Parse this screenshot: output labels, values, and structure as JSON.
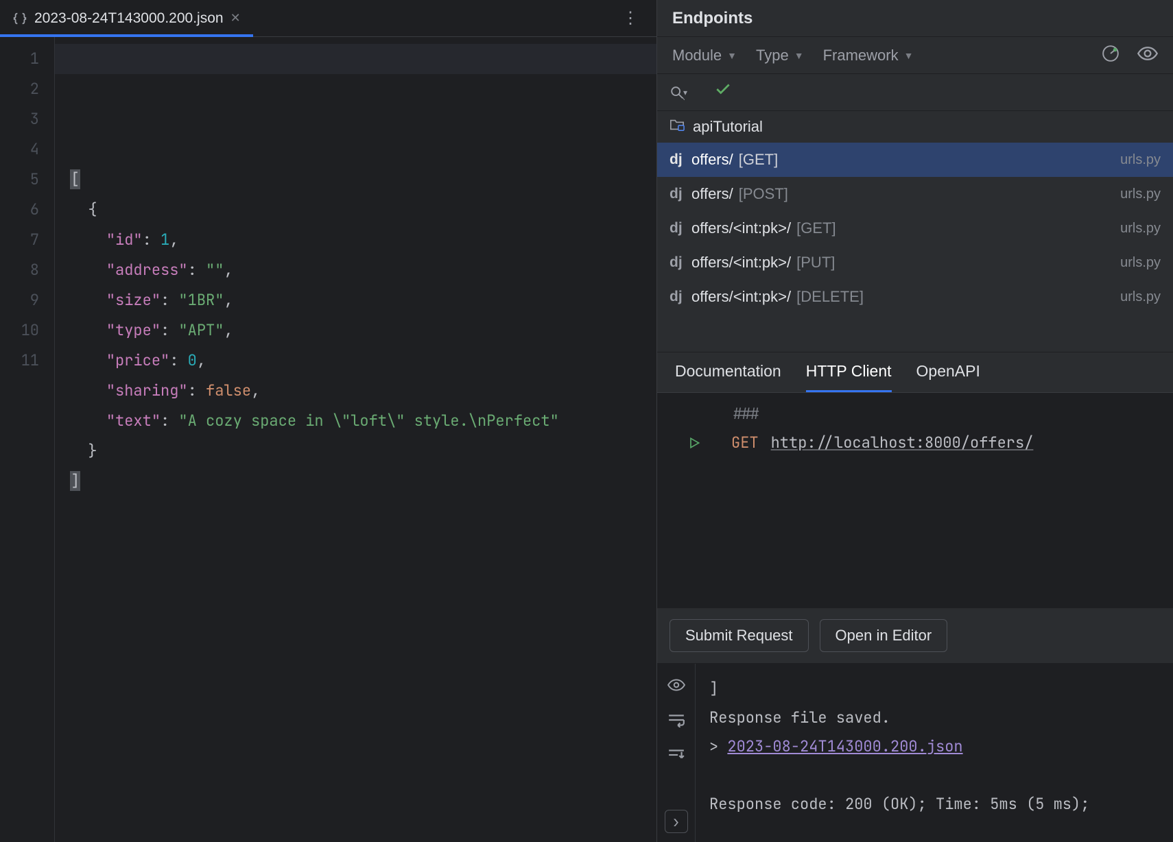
{
  "editor": {
    "tab_title": "2023-08-24T143000.200.json",
    "line_numbers": [
      "1",
      "2",
      "3",
      "4",
      "5",
      "6",
      "7",
      "8",
      "9",
      "10",
      "11"
    ],
    "json_content": {
      "id": 1,
      "address": "",
      "size": "1BR",
      "type": "APT",
      "price": 0,
      "sharing": false,
      "text": "A cozy space in \\\"loft\\\" style.\\nPerfect"
    }
  },
  "endpoints": {
    "title": "Endpoints",
    "filters": {
      "module": "Module",
      "type": "Type",
      "framework": "Framework"
    },
    "group": "apiTutorial",
    "list": [
      {
        "path": "offers/",
        "method": "[GET]",
        "source": "urls.py",
        "selected": true
      },
      {
        "path": "offers/",
        "method": "[POST]",
        "source": "urls.py",
        "selected": false
      },
      {
        "path": "offers/<int:pk>/",
        "method": "[GET]",
        "source": "urls.py",
        "selected": false
      },
      {
        "path": "offers/<int:pk>/",
        "method": "[PUT]",
        "source": "urls.py",
        "selected": false
      },
      {
        "path": "offers/<int:pk>/",
        "method": "[DELETE]",
        "source": "urls.py",
        "selected": false
      }
    ],
    "detail_tabs": {
      "documentation": "Documentation",
      "http_client": "HTTP Client",
      "openapi": "OpenAPI",
      "active": "http_client"
    },
    "http": {
      "separator": "###",
      "method": "GET",
      "url": "http://localhost:8000/offers/"
    },
    "actions": {
      "submit": "Submit Request",
      "open": "Open in Editor"
    },
    "response": {
      "tail_bracket": "]",
      "saved_msg": "Response file saved.",
      "file_link": "2023-08-24T143000.200.json",
      "status_line": "Response code: 200 (OK); Time: 5ms (5 ms);"
    }
  }
}
